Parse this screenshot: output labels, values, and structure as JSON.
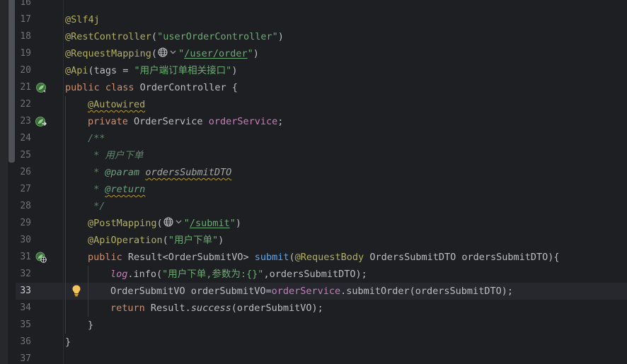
{
  "editor": {
    "language": "java",
    "current_line": 33,
    "line_numbers": [
      "16",
      "17",
      "18",
      "19",
      "20",
      "21",
      "22",
      "23",
      "24",
      "25",
      "26",
      "27",
      "28",
      "29",
      "30",
      "31",
      "32",
      "33",
      "34",
      "35",
      "36",
      "37"
    ],
    "lines": {
      "l17_annotation": "@Slf4j",
      "l18_annotation": "@RestController",
      "l18_open": "(",
      "l18_string": "\"userOrderController\"",
      "l18_close": ")",
      "l19_annotation": "@RequestMapping",
      "l19_open": "(",
      "l19_q1": "\"",
      "l19_path": "/user/order",
      "l19_q2": "\"",
      "l19_close": ")",
      "l20_annotation": "@Api",
      "l20_args": "(tags = ",
      "l20_string": "\"用户端订单相关接口\"",
      "l20_close": ")",
      "l21_kw": "public class ",
      "l21_name": "OrderController {",
      "l22_annotation": "@Autowired",
      "l23_kw": "private ",
      "l23_type": "OrderService ",
      "l23_field": "orderService",
      "l23_semi": ";",
      "l24_comment": "/**",
      "l25_comment": " * 用户下单",
      "l26_star": " * ",
      "l26_tag": "@param",
      "l26_sp": " ",
      "l26_value": "ordersSubmitDTO",
      "l27_star": " * ",
      "l27_tag": "@return",
      "l28_comment": " */",
      "l29_annotation": "@PostMapping",
      "l29_open": "(",
      "l29_q1": "\"",
      "l29_path": "/submit",
      "l29_q2": "\"",
      "l29_close": ")",
      "l30_annotation": "@ApiOperation",
      "l30_open": "(",
      "l30_string": "\"用户下单\"",
      "l30_close": ")",
      "l31_kw": "public ",
      "l31_type": "Result<OrderSubmitVO> ",
      "l31_method": "submit",
      "l31_open": "(",
      "l31_annotation": "@RequestBody",
      "l31_params": " OrdersSubmitDTO ordersSubmitDTO){",
      "l32_field": "log",
      "l32_call": ".info(",
      "l32_string": "\"用户下单,参数为:{}\"",
      "l32_rest": ",ordersSubmitDTO);",
      "l33_decl": "OrderSubmitVO orderSubmitVO=",
      "l33_field": "orderService",
      "l33_rest": ".submitOrder(ordersSubmitDTO);",
      "l34_kw": "return ",
      "l34_type": "Result.",
      "l34_static": "success",
      "l34_rest": "(orderSubmitVO);",
      "l35_brace": "}",
      "l36_brace": "}"
    }
  },
  "colors": {
    "background": "#1e1f22",
    "annotation": "#b3ae60",
    "string": "#6aab73",
    "keyword": "#cf8e6d",
    "field": "#c77dbb",
    "method": "#56a8f5",
    "comment": "#5f826b",
    "text": "#bcbec4"
  },
  "icons": {
    "gutter_line21": "spring-bean-icon",
    "gutter_line23": "spring-autowired-navigate-icon",
    "gutter_line31": "web-endpoint-icon",
    "inlay_url": "globe-icon",
    "intention": "lightbulb-icon"
  }
}
